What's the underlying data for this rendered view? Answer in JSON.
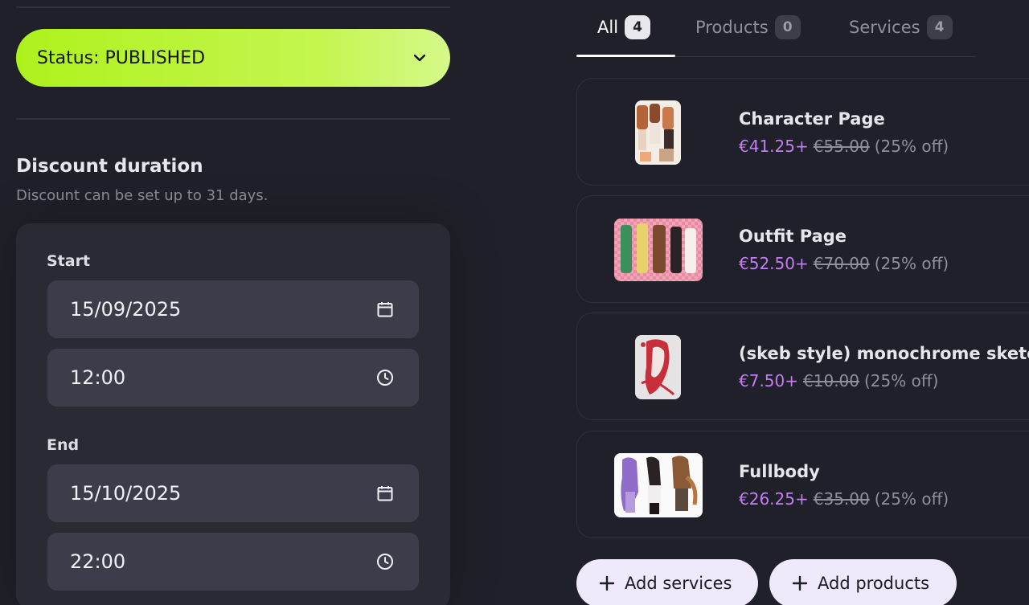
{
  "status": {
    "label": "Status: PUBLISHED",
    "icon": "chevron-down-icon"
  },
  "discount": {
    "title": "Discount duration",
    "subtitle": "Discount can be set up to 31 days.",
    "start": {
      "label": "Start",
      "date": "15/09/2025",
      "time": "12:00"
    },
    "end": {
      "label": "End",
      "date": "15/10/2025",
      "time": "22:00"
    }
  },
  "tabs": [
    {
      "label": "All",
      "count": "4",
      "active": true
    },
    {
      "label": "Products",
      "count": "0",
      "active": false
    },
    {
      "label": "Services",
      "count": "4",
      "active": false
    }
  ],
  "items": [
    {
      "name": "Character Page",
      "price": "€41.25+",
      "original": "€55.00",
      "discount": "(25% off)"
    },
    {
      "name": "Outfit Page",
      "price": "€52.50+",
      "original": "€70.00",
      "discount": "(25% off)"
    },
    {
      "name": "(skeb style) monochrome sketch",
      "price": "€7.50+",
      "original": "€10.00",
      "discount": "(25% off)"
    },
    {
      "name": "Fullbody",
      "price": "€26.25+",
      "original": "€35.00",
      "discount": "(25% off)"
    }
  ],
  "actions": {
    "add_services": "Add services",
    "add_products": "Add products"
  },
  "colors": {
    "status_gradient_start": "#aef21c",
    "status_gradient_end": "#d6f88a",
    "price_accent": "#c47ef2",
    "background": "#1f2029"
  }
}
